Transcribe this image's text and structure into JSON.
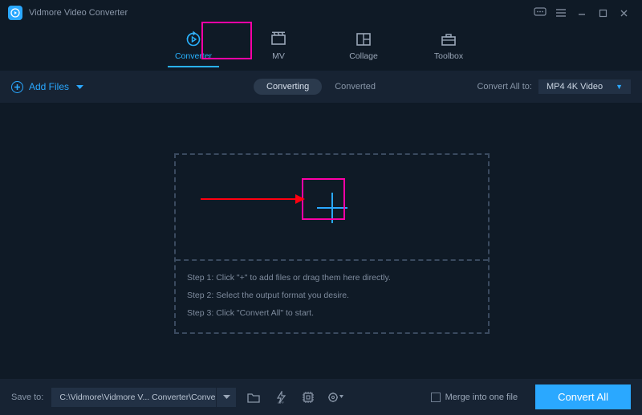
{
  "app": {
    "title": "Vidmore Video Converter"
  },
  "primary_tabs": {
    "converter": "Converter",
    "mv": "MV",
    "collage": "Collage",
    "toolbox": "Toolbox"
  },
  "actionbar": {
    "add_files": "Add Files",
    "converting": "Converting",
    "converted": "Converted",
    "convert_all_to": "Convert All to:",
    "format_selected": "MP4 4K Video"
  },
  "steps": {
    "s1": "Step 1: Click \"+\" to add files or drag them here directly.",
    "s2": "Step 2: Select the output format you desire.",
    "s3": "Step 3: Click \"Convert All\" to start."
  },
  "footer": {
    "save_to_label": "Save to:",
    "path": "C:\\Vidmore\\Vidmore V... Converter\\Converted",
    "merge": "Merge into one file",
    "convert_all": "Convert All"
  }
}
